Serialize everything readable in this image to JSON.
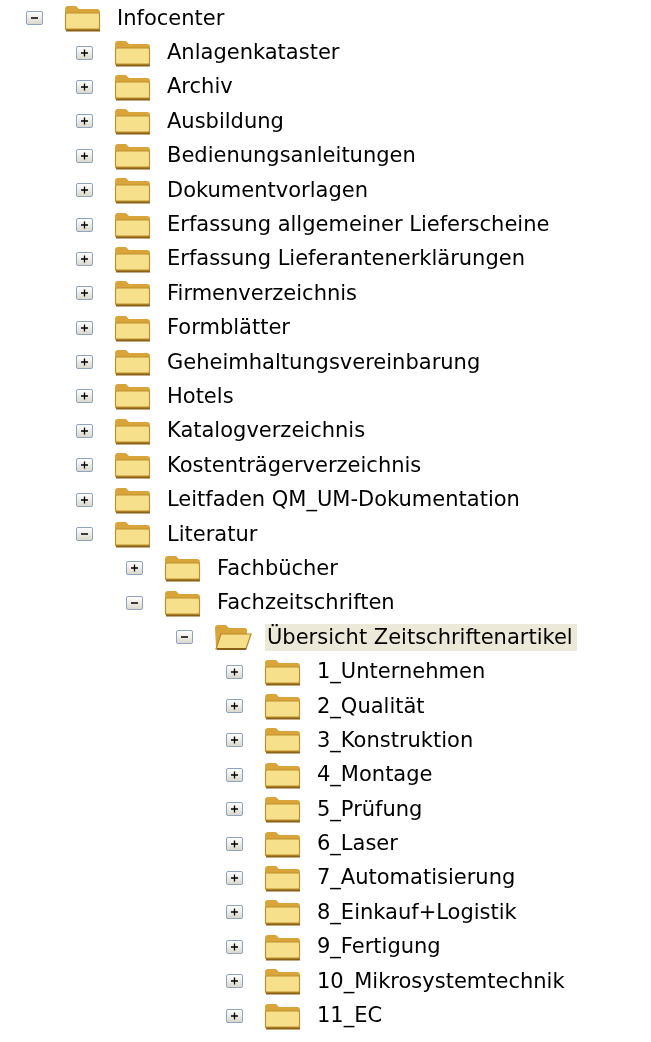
{
  "tree": [
    {
      "label": "Infocenter",
      "expanded": true,
      "selected": false,
      "children": [
        {
          "label": "Anlagenkataster",
          "expanded": false,
          "selected": false
        },
        {
          "label": "Archiv",
          "expanded": false,
          "selected": false
        },
        {
          "label": "Ausbildung",
          "expanded": false,
          "selected": false
        },
        {
          "label": "Bedienungsanleitungen",
          "expanded": false,
          "selected": false
        },
        {
          "label": "Dokumentvorlagen",
          "expanded": false,
          "selected": false
        },
        {
          "label": "Erfassung allgemeiner Lieferscheine",
          "expanded": false,
          "selected": false
        },
        {
          "label": "Erfassung Lieferantenerklärungen",
          "expanded": false,
          "selected": false
        },
        {
          "label": "Firmenverzeichnis",
          "expanded": false,
          "selected": false
        },
        {
          "label": "Formblätter",
          "expanded": false,
          "selected": false
        },
        {
          "label": "Geheimhaltungsvereinbarung",
          "expanded": false,
          "selected": false
        },
        {
          "label": "Hotels",
          "expanded": false,
          "selected": false
        },
        {
          "label": "Katalogverzeichnis",
          "expanded": false,
          "selected": false
        },
        {
          "label": "Kostenträgerverzeichnis",
          "expanded": false,
          "selected": false
        },
        {
          "label": "Leitfaden QM_UM-Dokumentation",
          "expanded": false,
          "selected": false
        },
        {
          "label": "Literatur",
          "expanded": true,
          "selected": false,
          "children": [
            {
              "label": "Fachbücher",
              "expanded": false,
              "selected": false
            },
            {
              "label": "Fachzeitschriften",
              "expanded": true,
              "selected": false,
              "children": [
                {
                  "label": "Übersicht Zeitschriftenartikel",
                  "expanded": true,
                  "selected": true,
                  "children": [
                    {
                      "label": "1_Unternehmen",
                      "expanded": false,
                      "selected": false
                    },
                    {
                      "label": "2_Qualität",
                      "expanded": false,
                      "selected": false
                    },
                    {
                      "label": "3_Konstruktion",
                      "expanded": false,
                      "selected": false
                    },
                    {
                      "label": "4_Montage",
                      "expanded": false,
                      "selected": false
                    },
                    {
                      "label": "5_Prüfung",
                      "expanded": false,
                      "selected": false
                    },
                    {
                      "label": "6_Laser",
                      "expanded": false,
                      "selected": false
                    },
                    {
                      "label": "7_Automatisierung",
                      "expanded": false,
                      "selected": false
                    },
                    {
                      "label": "8_Einkauf+Logistik",
                      "expanded": false,
                      "selected": false
                    },
                    {
                      "label": "9_Fertigung",
                      "expanded": false,
                      "selected": false
                    },
                    {
                      "label": "10_Mikrosystemtechnik",
                      "expanded": false,
                      "selected": false
                    },
                    {
                      "label": "11_EC",
                      "expanded": false,
                      "selected": false
                    }
                  ]
                }
              ]
            }
          ]
        }
      ]
    }
  ]
}
